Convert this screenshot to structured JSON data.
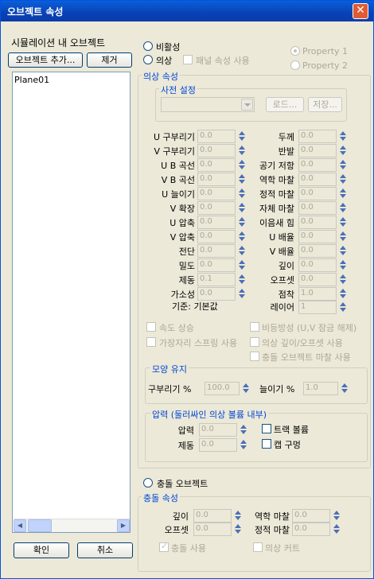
{
  "window": {
    "title": "오브젝트 속성",
    "close": "✕"
  },
  "left": {
    "heading": "시뮬레이션 내 오브젝트",
    "add": "오브젝트 추가...",
    "remove": "제거",
    "items": [
      "Plane01"
    ],
    "scroll_left": "◀",
    "scroll_right": "▶"
  },
  "footer": {
    "ok": "확인",
    "cancel": "취소"
  },
  "mode": {
    "inactive": "비활성",
    "cloth": "의상",
    "panel_props": "패널 속성 사용",
    "prop1": "Property 1",
    "prop2": "Property 2",
    "collision": "충돌 오브젝트"
  },
  "cloth": {
    "group": "의상 속성",
    "preset_group": "사전 설정",
    "load": "로드...",
    "save": "저장...",
    "left_fields": [
      {
        "label": "U 구부리기",
        "value": "0.0"
      },
      {
        "label": "V 구부리기",
        "value": "0.0"
      },
      {
        "label": "U B 곡선",
        "value": "0.0"
      },
      {
        "label": "V B 곡선",
        "value": "0.0"
      },
      {
        "label": "U 늘이기",
        "value": "0.0"
      },
      {
        "label": "V 확장",
        "value": "0.0"
      },
      {
        "label": "U 압축",
        "value": "0.0"
      },
      {
        "label": "V 압축",
        "value": "0.0"
      },
      {
        "label": "전단",
        "value": "0.0"
      },
      {
        "label": "밀도",
        "value": "0.0"
      },
      {
        "label": "제동",
        "value": "0.1"
      },
      {
        "label": "가소성",
        "value": "0.0"
      }
    ],
    "right_fields": [
      {
        "label": "두께",
        "value": "0.0"
      },
      {
        "label": "반발",
        "value": "0.0"
      },
      {
        "label": "공기 저항",
        "value": "0.0"
      },
      {
        "label": "역학 마찰",
        "value": "0.0"
      },
      {
        "label": "정적 마찰",
        "value": "0.0"
      },
      {
        "label": "자체 마찰",
        "value": "0.0"
      },
      {
        "label": "이음새 힘",
        "value": "0.0"
      },
      {
        "label": "U 배율",
        "value": "0.0"
      },
      {
        "label": "V 배율",
        "value": "0.0"
      },
      {
        "label": "깊이",
        "value": "0.0"
      },
      {
        "label": "오프셋",
        "value": "0.0"
      },
      {
        "label": "점착",
        "value": "1.0"
      }
    ],
    "basis": "기준: 기본값",
    "layer_label": "레이어",
    "layer_value": "1",
    "speed_up": "속도 상승",
    "aniso": "비등방성 (U,V 잠금 해제)",
    "edge_spring": "가장자리 스프링 사용",
    "depth_offset": "의상 깊이/오프셋 사용",
    "collision_friction": "충돌 오브젝트 마찰 사용"
  },
  "shape": {
    "group": "모양 유지",
    "bend_label": "구부리기 %",
    "bend_value": "100.0",
    "stretch_label": "늘이기 %",
    "stretch_value": "1.0"
  },
  "pressure": {
    "group": "압력 (둘러싸인 의상 볼륨 내부)",
    "pressure_label": "압력",
    "pressure_value": "0.0",
    "damping_label": "제동",
    "damping_value": "0.0",
    "track_volume": "트랙 볼륨",
    "cap_holes": "캡 구멍"
  },
  "collision": {
    "group": "충돌 속성",
    "depth_label": "깊이",
    "depth_value": "0.0",
    "offset_label": "오프셋",
    "offset_value": "0.0",
    "dyn_label": "역학 마찰",
    "dyn_value": "0.0",
    "static_label": "정적 마찰",
    "static_value": "0.0",
    "use": "충돌 사용",
    "cut": "의상 커트"
  }
}
